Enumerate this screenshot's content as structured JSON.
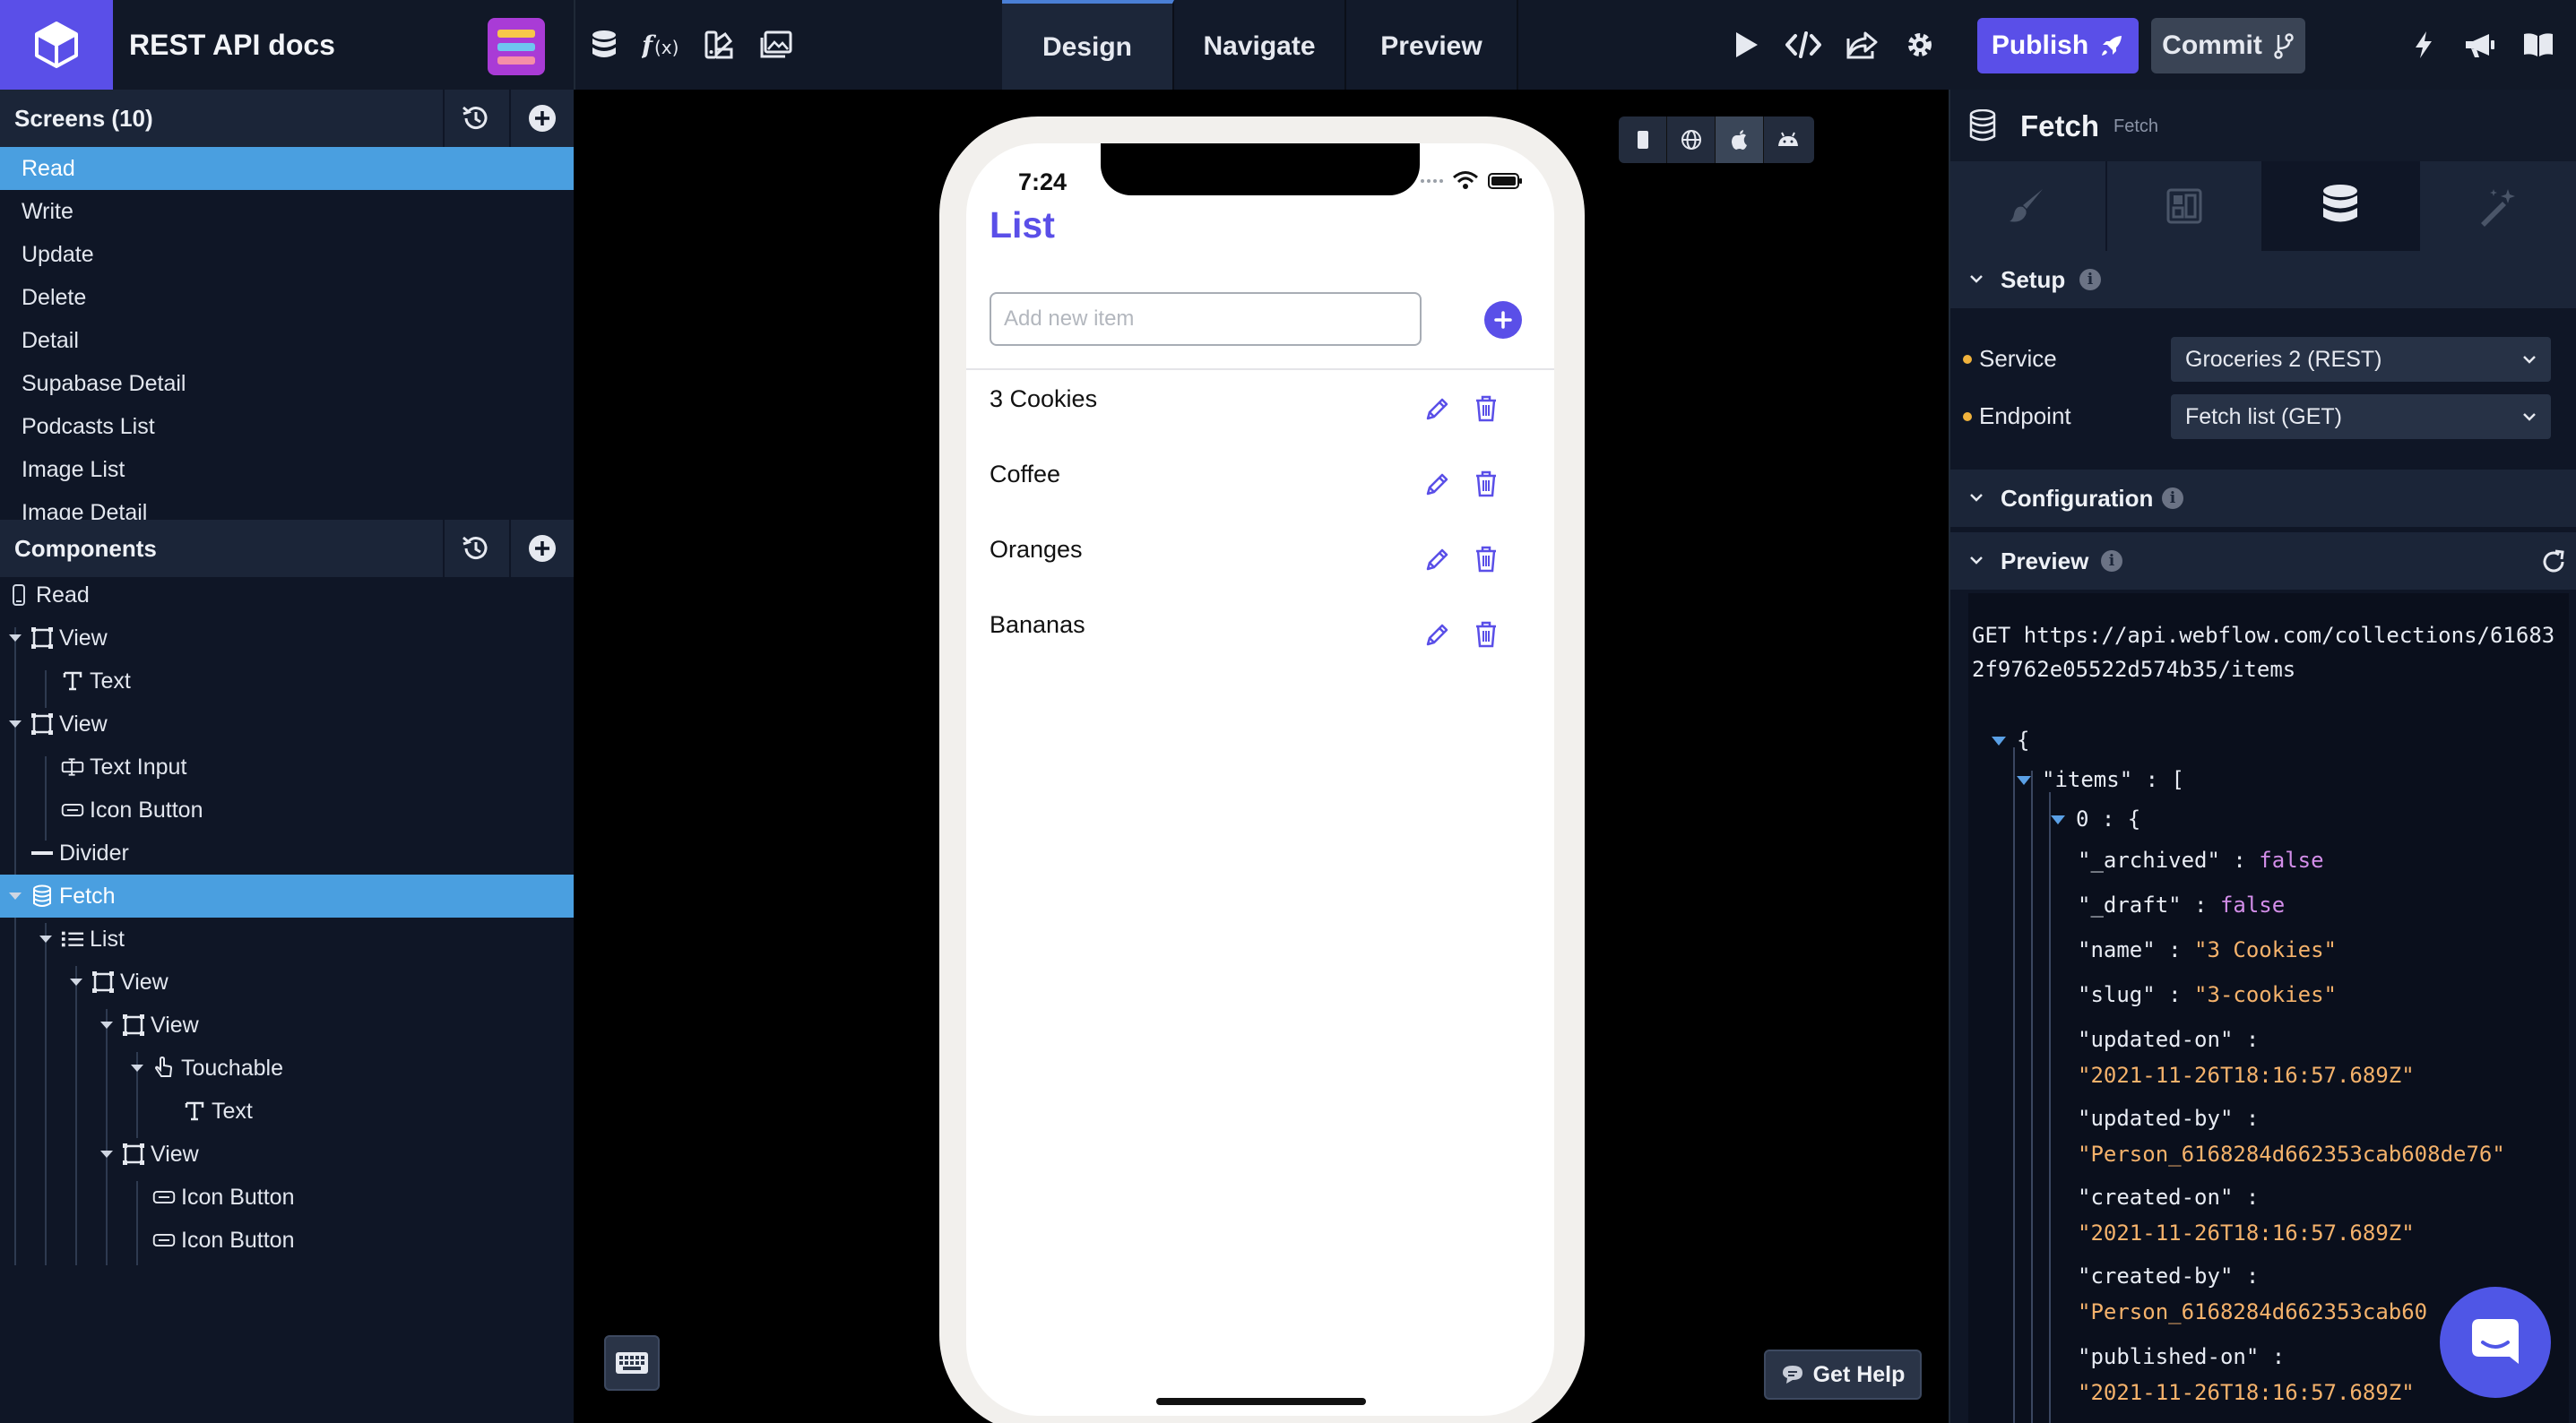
{
  "app": {
    "title": "REST API docs"
  },
  "top_tabs": [
    {
      "label": "Design",
      "active": true
    },
    {
      "label": "Navigate",
      "active": false
    },
    {
      "label": "Preview",
      "active": false
    }
  ],
  "actions": {
    "publish_label": "Publish",
    "commit_label": "Commit"
  },
  "screens": {
    "header": "Screens (10)",
    "items": [
      {
        "label": "Read",
        "active": true
      },
      {
        "label": "Write",
        "active": false
      },
      {
        "label": "Update",
        "active": false
      },
      {
        "label": "Delete",
        "active": false
      },
      {
        "label": "Detail",
        "active": false
      },
      {
        "label": "Supabase Detail",
        "active": false
      },
      {
        "label": "Podcasts List",
        "active": false
      },
      {
        "label": "Image List",
        "active": false
      },
      {
        "label": "Image Detail",
        "active": false
      }
    ]
  },
  "components": {
    "header": "Components",
    "tree": [
      {
        "label": "Read",
        "icon": "phone-icon",
        "depth": 0,
        "caret": false
      },
      {
        "label": "View",
        "icon": "view-icon",
        "depth": 1,
        "caret": true
      },
      {
        "label": "Text",
        "icon": "text-icon",
        "depth": 2,
        "caret": false
      },
      {
        "label": "View",
        "icon": "view-icon",
        "depth": 1,
        "caret": true
      },
      {
        "label": "Text Input",
        "icon": "text-input-icon",
        "depth": 2,
        "caret": false
      },
      {
        "label": "Icon Button",
        "icon": "icon-button-icon",
        "depth": 2,
        "caret": false
      },
      {
        "label": "Divider",
        "icon": "divider-icon",
        "depth": 1,
        "caret": false
      },
      {
        "label": "Fetch",
        "icon": "database-icon",
        "depth": 1,
        "caret": true,
        "active": true
      },
      {
        "label": "List",
        "icon": "list-icon",
        "depth": 2,
        "caret": true
      },
      {
        "label": "View",
        "icon": "view-icon",
        "depth": 3,
        "caret": true
      },
      {
        "label": "View",
        "icon": "view-icon",
        "depth": 4,
        "caret": true
      },
      {
        "label": "Touchable",
        "icon": "touchable-icon",
        "depth": 5,
        "caret": true
      },
      {
        "label": "Text",
        "icon": "text-icon",
        "depth": 6,
        "caret": false
      },
      {
        "label": "View",
        "icon": "view-icon",
        "depth": 4,
        "caret": true
      },
      {
        "label": "Icon Button",
        "icon": "icon-button-icon",
        "depth": 5,
        "caret": false
      },
      {
        "label": "Icon Button",
        "icon": "icon-button-icon",
        "depth": 5,
        "caret": false
      }
    ]
  },
  "phone": {
    "time": "7:24",
    "title": "List",
    "input_placeholder": "Add new item",
    "items": [
      "3 Cookies",
      "Coffee",
      "Oranges",
      "Bananas"
    ]
  },
  "canvas": {
    "help_label": "Get Help"
  },
  "inspector": {
    "title": "Fetch",
    "subtitle": "Fetch",
    "setup": {
      "label": "Setup",
      "service_label": "Service",
      "service_value": "Groceries 2 (REST)",
      "endpoint_label": "Endpoint",
      "endpoint_value": "Fetch list (GET)"
    },
    "configuration_label": "Configuration",
    "preview_label": "Preview",
    "request": "GET https://api.webflow.com/collections/616832f9762e05522d574b35/items",
    "json_lines": [
      {
        "indent": 0,
        "caret": true,
        "parts": [
          {
            "c": "ckey",
            "t": "{"
          }
        ]
      },
      {
        "indent": 1,
        "caret": true,
        "parts": [
          {
            "c": "ckey",
            "t": "\"items\" : ["
          }
        ]
      },
      {
        "indent": 2,
        "caret": true,
        "parts": [
          {
            "c": "ckey",
            "t": "0 : {"
          }
        ]
      },
      {
        "indent": 3,
        "caret": false,
        "parts": [
          {
            "c": "ckey",
            "t": "\"_archived\" : "
          },
          {
            "c": "cbool",
            "t": "false"
          }
        ]
      },
      {
        "indent": 3,
        "caret": false,
        "parts": [
          {
            "c": "ckey",
            "t": "\"_draft\" : "
          },
          {
            "c": "cbool",
            "t": "false"
          }
        ]
      },
      {
        "indent": 3,
        "caret": false,
        "parts": [
          {
            "c": "ckey",
            "t": "\"name\" : "
          },
          {
            "c": "cstr",
            "t": "\"3 Cookies\""
          }
        ]
      },
      {
        "indent": 3,
        "caret": false,
        "parts": [
          {
            "c": "ckey",
            "t": "\"slug\" : "
          },
          {
            "c": "cstr",
            "t": "\"3-cookies\""
          }
        ]
      },
      {
        "indent": 3,
        "caret": false,
        "parts": [
          {
            "c": "ckey",
            "t": "\"updated-on\" :"
          }
        ]
      },
      {
        "indent": 3,
        "caret": false,
        "parts": [
          {
            "c": "cstr",
            "t": "\"2021-11-26T18:16:57.689Z\""
          }
        ]
      },
      {
        "indent": 3,
        "caret": false,
        "parts": [
          {
            "c": "ckey",
            "t": "\"updated-by\" :"
          }
        ]
      },
      {
        "indent": 3,
        "caret": false,
        "parts": [
          {
            "c": "cstr",
            "t": "\"Person_6168284d662353cab608de76\""
          }
        ]
      },
      {
        "indent": 3,
        "caret": false,
        "parts": [
          {
            "c": "ckey",
            "t": "\"created-on\" :"
          }
        ]
      },
      {
        "indent": 3,
        "caret": false,
        "parts": [
          {
            "c": "cstr",
            "t": "\"2021-11-26T18:16:57.689Z\""
          }
        ]
      },
      {
        "indent": 3,
        "caret": false,
        "parts": [
          {
            "c": "ckey",
            "t": "\"created-by\" :"
          }
        ]
      },
      {
        "indent": 3,
        "caret": false,
        "parts": [
          {
            "c": "cstr",
            "t": "\"Person_6168284d662353cab60"
          }
        ]
      },
      {
        "indent": 3,
        "caret": false,
        "parts": [
          {
            "c": "ckey",
            "t": "\"published-on\" :"
          }
        ]
      },
      {
        "indent": 3,
        "caret": false,
        "parts": [
          {
            "c": "cstr",
            "t": "\"2021-11-26T18:16:57.689Z\""
          }
        ]
      }
    ]
  },
  "colors": {
    "accent": "#5a4fe8",
    "selection": "#4a9fe0",
    "panel": "#0f1626"
  }
}
